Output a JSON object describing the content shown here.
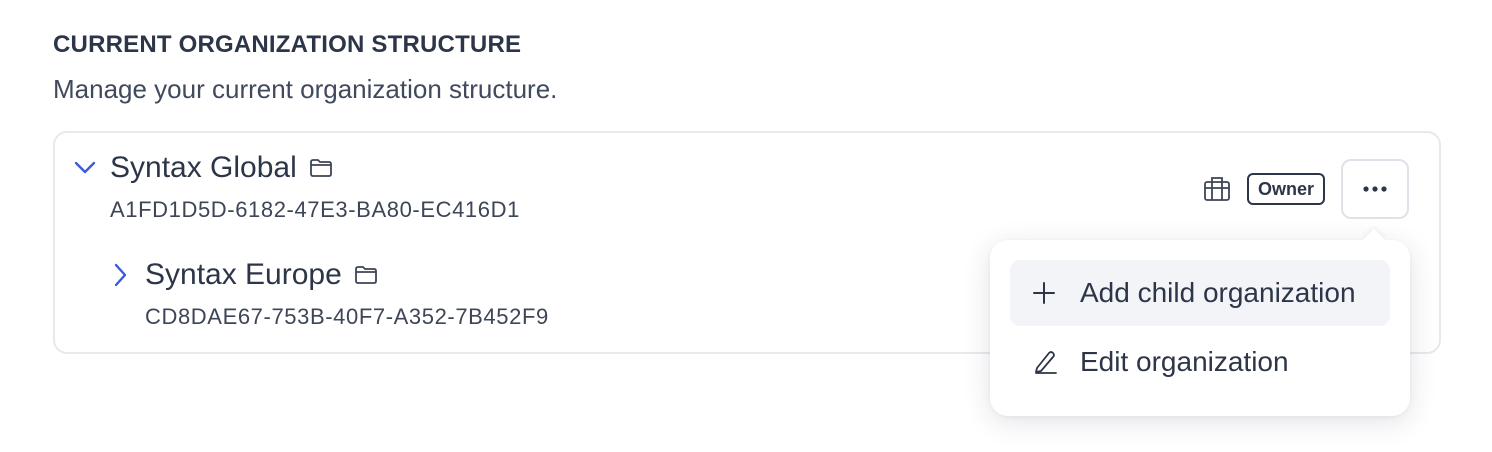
{
  "section": {
    "title": "CURRENT ORGANIZATION STRUCTURE",
    "description": "Manage your current organization structure."
  },
  "tree": {
    "root": {
      "name": "Syntax Global",
      "id": "A1FD1D5D-6182-47E3-BA80-EC416D1",
      "expanded": true,
      "icon": "folder-icon",
      "badge": "Owner"
    },
    "children": [
      {
        "name": "Syntax Europe",
        "id": "CD8DAE67-753B-40F7-A352-7B452F9",
        "expanded": false,
        "icon": "folder-icon"
      }
    ]
  },
  "menu": {
    "items": [
      {
        "label": "Add child organization",
        "icon": "plus-icon"
      },
      {
        "label": "Edit organization",
        "icon": "pencil-icon"
      }
    ]
  },
  "colors": {
    "text": "#2d3648",
    "chevron": "#3b5bdb",
    "border": "#e7e9ee",
    "hover": "#f3f4f8"
  }
}
